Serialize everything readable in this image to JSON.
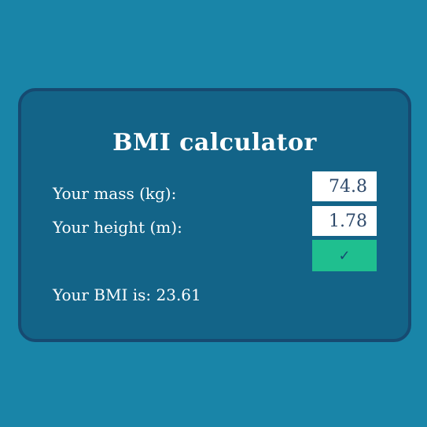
{
  "app": {
    "title": "BMI calculator"
  },
  "form": {
    "mass_label": "Your mass (kg):",
    "mass_value": "74.8",
    "height_label": "Your height (m):",
    "height_value": "1.78",
    "submit_icon": "check-icon",
    "submit_glyph": "✓"
  },
  "result": {
    "prefix": "Your BMI is:",
    "value": "23.61"
  },
  "colors": {
    "page_background": "#1985a8",
    "card_background": "#136488",
    "card_border": "#164a71",
    "button": "#1fbf8f",
    "input_text": "#2f4a6b"
  }
}
